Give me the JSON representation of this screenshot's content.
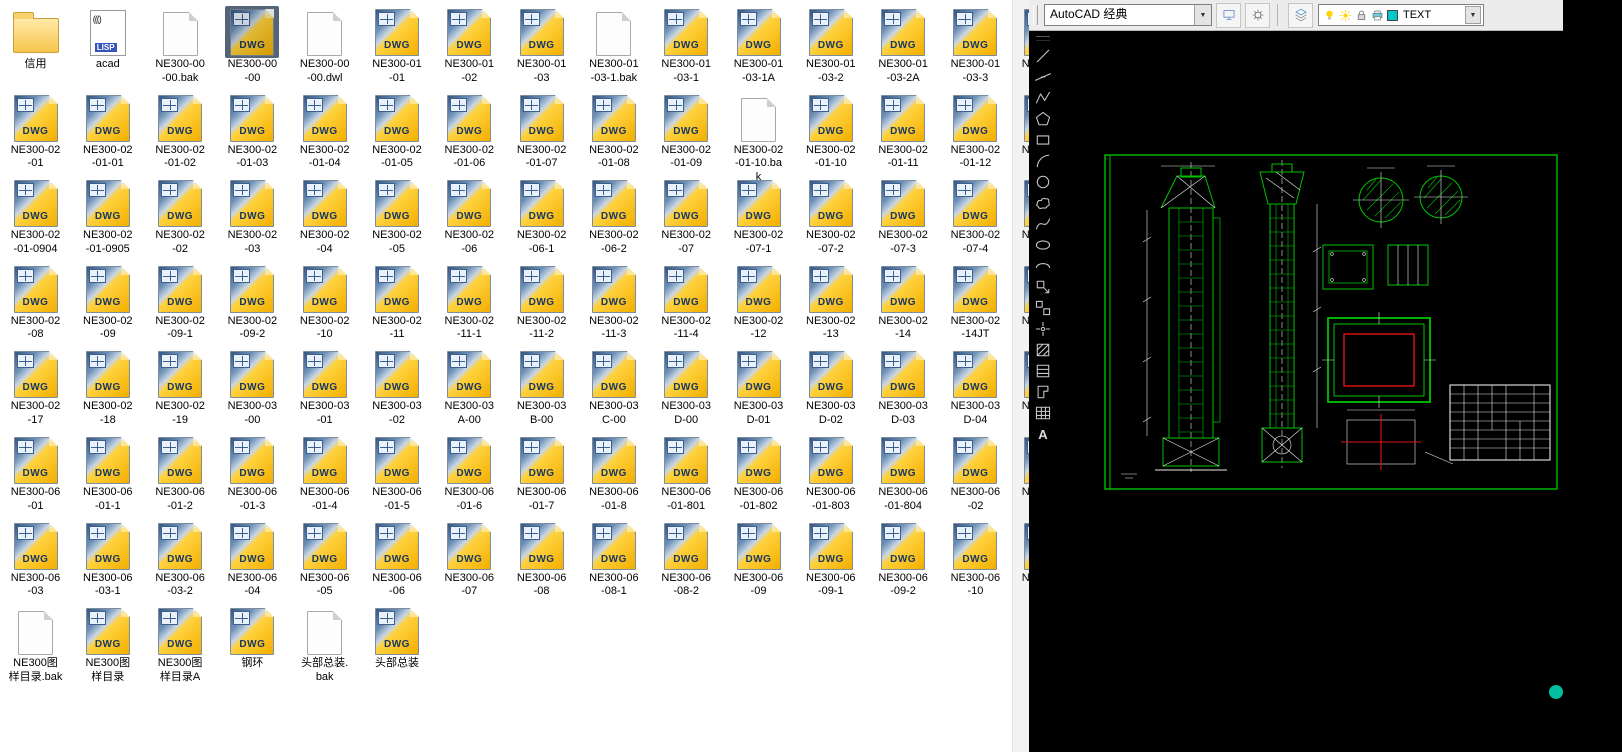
{
  "explorer": {
    "dwg_badge": "DWG",
    "lisp_badge": "LISP",
    "lisp_text": "((()",
    "rows": [
      [
        {
          "label": "信用",
          "type": "folder"
        },
        {
          "label": "acad",
          "type": "lisp"
        },
        {
          "label": "NE300-00\n-00.bak",
          "type": "bak"
        },
        {
          "label": "NE300-00\n-00",
          "type": "dwg",
          "selected": true
        },
        {
          "label": "NE300-00\n-00.dwl",
          "type": "dwl"
        },
        {
          "label": "NE300-01\n-01",
          "type": "dwg"
        },
        {
          "label": "NE300-01\n-02",
          "type": "dwg"
        },
        {
          "label": "NE300-01\n-03",
          "type": "dwg"
        },
        {
          "label": "NE300-01\n-03-1.bak",
          "type": "bak"
        },
        {
          "label": "NE300-01\n-03-1",
          "type": "dwg"
        },
        {
          "label": "NE300-01\n-03-1A",
          "type": "dwg"
        },
        {
          "label": "NE300-01\n-03-2",
          "type": "dwg"
        },
        {
          "label": "NE300-01\n-03-2A",
          "type": "dwg"
        },
        {
          "label": "NE300-01\n-03-3",
          "type": "dwg"
        },
        {
          "label": "N",
          "type": "dwg",
          "cut": true
        }
      ],
      [
        {
          "label": "NE300-02\n-01",
          "type": "dwg"
        },
        {
          "label": "NE300-02\n-01-01",
          "type": "dwg"
        },
        {
          "label": "NE300-02\n-01-02",
          "type": "dwg"
        },
        {
          "label": "NE300-02\n-01-03",
          "type": "dwg"
        },
        {
          "label": "NE300-02\n-01-04",
          "type": "dwg"
        },
        {
          "label": "NE300-02\n-01-05",
          "type": "dwg"
        },
        {
          "label": "NE300-02\n-01-06",
          "type": "dwg"
        },
        {
          "label": "NE300-02\n-01-07",
          "type": "dwg"
        },
        {
          "label": "NE300-02\n-01-08",
          "type": "dwg"
        },
        {
          "label": "NE300-02\n-01-09",
          "type": "dwg"
        },
        {
          "label": "NE300-02\n-01-10.ba\nk",
          "type": "bak"
        },
        {
          "label": "NE300-02\n-01-10",
          "type": "dwg"
        },
        {
          "label": "NE300-02\n-01-11",
          "type": "dwg"
        },
        {
          "label": "NE300-02\n-01-12",
          "type": "dwg"
        },
        {
          "label": "N",
          "type": "dwg",
          "cut": true
        }
      ],
      [
        {
          "label": "NE300-02\n-01-0904",
          "type": "dwg"
        },
        {
          "label": "NE300-02\n-01-0905",
          "type": "dwg"
        },
        {
          "label": "NE300-02\n-02",
          "type": "dwg"
        },
        {
          "label": "NE300-02\n-03",
          "type": "dwg"
        },
        {
          "label": "NE300-02\n-04",
          "type": "dwg"
        },
        {
          "label": "NE300-02\n-05",
          "type": "dwg"
        },
        {
          "label": "NE300-02\n-06",
          "type": "dwg"
        },
        {
          "label": "NE300-02\n-06-1",
          "type": "dwg"
        },
        {
          "label": "NE300-02\n-06-2",
          "type": "dwg"
        },
        {
          "label": "NE300-02\n-07",
          "type": "dwg"
        },
        {
          "label": "NE300-02\n-07-1",
          "type": "dwg"
        },
        {
          "label": "NE300-02\n-07-2",
          "type": "dwg"
        },
        {
          "label": "NE300-02\n-07-3",
          "type": "dwg"
        },
        {
          "label": "NE300-02\n-07-4",
          "type": "dwg"
        },
        {
          "label": "N",
          "type": "dwg",
          "cut": true
        }
      ],
      [
        {
          "label": "NE300-02\n-08",
          "type": "dwg"
        },
        {
          "label": "NE300-02\n-09",
          "type": "dwg"
        },
        {
          "label": "NE300-02\n-09-1",
          "type": "dwg"
        },
        {
          "label": "NE300-02\n-09-2",
          "type": "dwg"
        },
        {
          "label": "NE300-02\n-10",
          "type": "dwg"
        },
        {
          "label": "NE300-02\n-11",
          "type": "dwg"
        },
        {
          "label": "NE300-02\n-11-1",
          "type": "dwg"
        },
        {
          "label": "NE300-02\n-11-2",
          "type": "dwg"
        },
        {
          "label": "NE300-02\n-11-3",
          "type": "dwg"
        },
        {
          "label": "NE300-02\n-11-4",
          "type": "dwg"
        },
        {
          "label": "NE300-02\n-12",
          "type": "dwg"
        },
        {
          "label": "NE300-02\n-13",
          "type": "dwg"
        },
        {
          "label": "NE300-02\n-14",
          "type": "dwg"
        },
        {
          "label": "NE300-02\n-14JT",
          "type": "dwg"
        },
        {
          "label": "N",
          "type": "dwg",
          "cut": true
        }
      ],
      [
        {
          "label": "NE300-02\n-17",
          "type": "dwg"
        },
        {
          "label": "NE300-02\n-18",
          "type": "dwg"
        },
        {
          "label": "NE300-02\n-19",
          "type": "dwg"
        },
        {
          "label": "NE300-03\n-00",
          "type": "dwg"
        },
        {
          "label": "NE300-03\n-01",
          "type": "dwg"
        },
        {
          "label": "NE300-03\n-02",
          "type": "dwg"
        },
        {
          "label": "NE300-03\nA-00",
          "type": "dwg"
        },
        {
          "label": "NE300-03\nB-00",
          "type": "dwg"
        },
        {
          "label": "NE300-03\nC-00",
          "type": "dwg"
        },
        {
          "label": "NE300-03\nD-00",
          "type": "dwg"
        },
        {
          "label": "NE300-03\nD-01",
          "type": "dwg"
        },
        {
          "label": "NE300-03\nD-02",
          "type": "dwg"
        },
        {
          "label": "NE300-03\nD-03",
          "type": "dwg"
        },
        {
          "label": "NE300-03\nD-04",
          "type": "dwg"
        },
        {
          "label": "N",
          "type": "dwg",
          "cut": true
        }
      ],
      [
        {
          "label": "NE300-06\n-01",
          "type": "dwg"
        },
        {
          "label": "NE300-06\n-01-1",
          "type": "dwg"
        },
        {
          "label": "NE300-06\n-01-2",
          "type": "dwg"
        },
        {
          "label": "NE300-06\n-01-3",
          "type": "dwg"
        },
        {
          "label": "NE300-06\n-01-4",
          "type": "dwg"
        },
        {
          "label": "NE300-06\n-01-5",
          "type": "dwg"
        },
        {
          "label": "NE300-06\n-01-6",
          "type": "dwg"
        },
        {
          "label": "NE300-06\n-01-7",
          "type": "dwg"
        },
        {
          "label": "NE300-06\n-01-8",
          "type": "dwg"
        },
        {
          "label": "NE300-06\n-01-801",
          "type": "dwg"
        },
        {
          "label": "NE300-06\n-01-802",
          "type": "dwg"
        },
        {
          "label": "NE300-06\n-01-803",
          "type": "dwg"
        },
        {
          "label": "NE300-06\n-01-804",
          "type": "dwg"
        },
        {
          "label": "NE300-06\n-02",
          "type": "dwg"
        },
        {
          "label": "N",
          "type": "dwg",
          "cut": true
        }
      ],
      [
        {
          "label": "NE300-06\n-03",
          "type": "dwg"
        },
        {
          "label": "NE300-06\n-03-1",
          "type": "dwg"
        },
        {
          "label": "NE300-06\n-03-2",
          "type": "dwg"
        },
        {
          "label": "NE300-06\n-04",
          "type": "dwg"
        },
        {
          "label": "NE300-06\n-05",
          "type": "dwg"
        },
        {
          "label": "NE300-06\n-06",
          "type": "dwg"
        },
        {
          "label": "NE300-06\n-07",
          "type": "dwg"
        },
        {
          "label": "NE300-06\n-08",
          "type": "dwg"
        },
        {
          "label": "NE300-06\n-08-1",
          "type": "dwg"
        },
        {
          "label": "NE300-06\n-08-2",
          "type": "dwg"
        },
        {
          "label": "NE300-06\n-09",
          "type": "dwg"
        },
        {
          "label": "NE300-06\n-09-1",
          "type": "dwg"
        },
        {
          "label": "NE300-06\n-09-2",
          "type": "dwg"
        },
        {
          "label": "NE300-06\n-10",
          "type": "dwg"
        },
        {
          "label": "N",
          "type": "dwg",
          "cut": true
        }
      ],
      [
        {
          "label": "NE300图\n样目录.bak",
          "type": "bak"
        },
        {
          "label": "NE300图\n样目录",
          "type": "dwg"
        },
        {
          "label": "NE300图\n样目录A",
          "type": "dwg"
        },
        {
          "label": "钢环",
          "type": "dwg"
        },
        {
          "label": "头部总装.\nbak",
          "type": "bak"
        },
        {
          "label": "头部总装",
          "type": "dwg"
        }
      ]
    ]
  },
  "acad": {
    "toolbar": {
      "workspace_label": "AutoCAD 经典",
      "layer_name": "TEXT"
    },
    "draw_toolbar": {
      "tools": [
        {
          "id": "line",
          "name": "Line"
        },
        {
          "id": "construction-line",
          "name": "Construction Line"
        },
        {
          "id": "polyline",
          "name": "Polyline"
        },
        {
          "id": "polygon",
          "name": "Polygon"
        },
        {
          "id": "rectangle",
          "name": "Rectangle"
        },
        {
          "id": "arc",
          "name": "Arc"
        },
        {
          "id": "circle",
          "name": "Circle"
        },
        {
          "id": "revision-cloud",
          "name": "Revision Cloud"
        },
        {
          "id": "spline",
          "name": "Spline"
        },
        {
          "id": "ellipse",
          "name": "Ellipse"
        },
        {
          "id": "ellipse-arc",
          "name": "Ellipse Arc"
        },
        {
          "id": "insert-block",
          "name": "Insert Block"
        },
        {
          "id": "make-block",
          "name": "Make Block"
        },
        {
          "id": "point",
          "name": "Point"
        },
        {
          "id": "hatch",
          "name": "Hatch"
        },
        {
          "id": "gradient",
          "name": "Gradient"
        },
        {
          "id": "region",
          "name": "Region"
        },
        {
          "id": "table",
          "name": "Table"
        },
        {
          "id": "mtext",
          "name": "Multiline Text",
          "label": "A"
        }
      ]
    },
    "canvas": {
      "colors": {
        "green": "#00c300",
        "cyan": "#00d7d7",
        "white": "#e8e8e8",
        "red": "#e01414",
        "yellow": "#e8e800",
        "magenta": "#e000e0"
      }
    },
    "status_dot_color": "#00bfa0"
  }
}
